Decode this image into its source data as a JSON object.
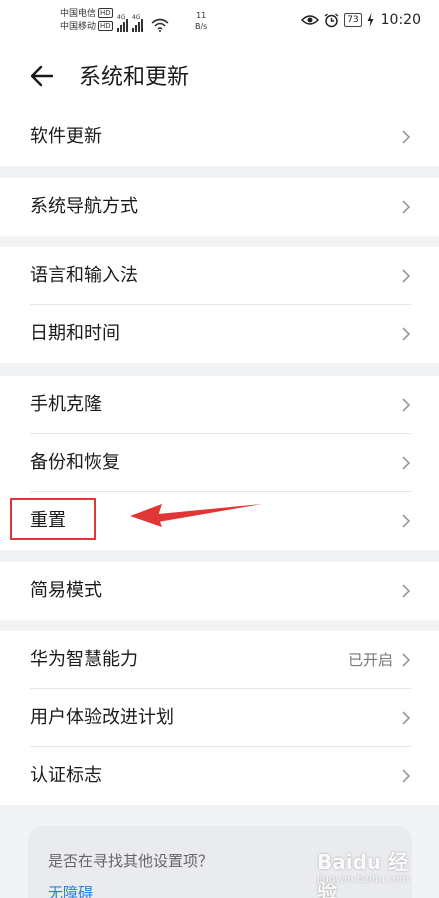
{
  "status_bar": {
    "carrier_1": "中国电信",
    "carrier_2": "中国移动",
    "hd_badge": "HD",
    "network_tag": "4G",
    "speed_value": "11",
    "speed_unit": "B/s",
    "battery": "73",
    "time": "10:20"
  },
  "header": {
    "title": "系统和更新"
  },
  "groups": [
    {
      "items": [
        {
          "label": "软件更新"
        }
      ]
    },
    {
      "items": [
        {
          "label": "系统导航方式"
        }
      ]
    },
    {
      "items": [
        {
          "label": "语言和输入法"
        },
        {
          "label": "日期和时间"
        }
      ]
    },
    {
      "items": [
        {
          "label": "手机克隆"
        },
        {
          "label": "备份和恢复"
        },
        {
          "label": "重置"
        }
      ]
    },
    {
      "items": [
        {
          "label": "简易模式"
        }
      ]
    },
    {
      "items": [
        {
          "label": "华为智慧能力",
          "value": "已开启"
        },
        {
          "label": "用户体验改进计划"
        },
        {
          "label": "认证标志"
        }
      ]
    }
  ],
  "suggestion": {
    "question": "是否在寻找其他设置项？",
    "link": "无障碍"
  },
  "watermark": {
    "text": "Baidu 经验",
    "sub": "jingyan.baidu.com"
  },
  "colors": {
    "annotation": "#e13636",
    "link": "#2a7de1",
    "background": "#f1f3f5"
  }
}
